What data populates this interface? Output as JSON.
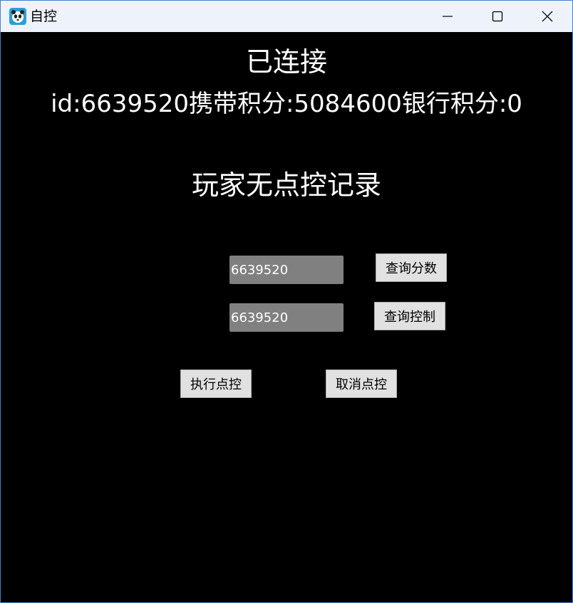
{
  "window": {
    "title": "自控",
    "app_icon": "panda-app-icon",
    "controls": {
      "minimize_icon": "minimize-icon",
      "maximize_icon": "maximize-icon",
      "close_icon": "close-icon"
    }
  },
  "main": {
    "status_text": "已连接",
    "info_text": "id:6639520携带积分:5084600银行积分:0",
    "record_text": "玩家无点控记录",
    "score_field": {
      "value": "6639520"
    },
    "control_field": {
      "value": "6639520"
    },
    "query_score_label": "查询分数",
    "query_control_label": "查询控制",
    "execute_label": "执行点控",
    "cancel_label": "取消点控"
  },
  "colors": {
    "background": "#000000",
    "titlebar": "#eef3fb",
    "field": "#808080",
    "button": "#e1e1e1",
    "text": "#ffffff"
  }
}
